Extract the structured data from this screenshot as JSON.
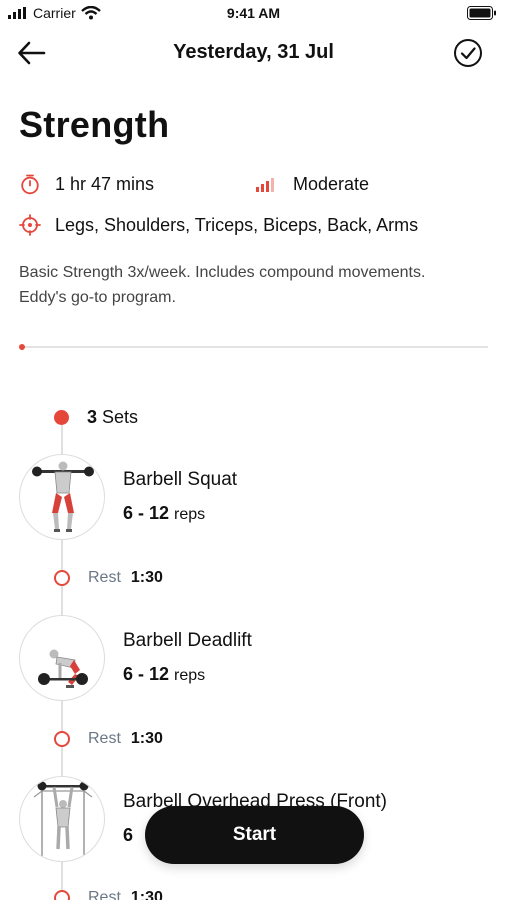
{
  "status_bar": {
    "carrier": "Carrier",
    "time": "9:41 AM"
  },
  "nav": {
    "title": "Yesterday, 31 Jul"
  },
  "workout": {
    "title": "Strength",
    "duration": "1 hr 47 mins",
    "intensity": "Moderate",
    "muscles": "Legs, Shoulders, Triceps, Biceps, Back, Arms",
    "description": "Basic Strength 3x/week. Includes compound movements. Eddy's go-to program."
  },
  "sets": {
    "count": "3",
    "label": "Sets"
  },
  "exercises": [
    {
      "name": "Barbell Squat",
      "reps_num": "6 - 12",
      "reps_unit": "reps"
    },
    {
      "name": "Barbell Deadlift",
      "reps_num": "6 - 12",
      "reps_unit": "reps"
    },
    {
      "name": "Barbell Overhead Press (Front)",
      "reps_num": "6",
      "reps_unit": ""
    }
  ],
  "rests": [
    {
      "label": "Rest",
      "value": "1:30"
    },
    {
      "label": "Rest",
      "value": "1:30"
    },
    {
      "label": "Rest",
      "value": "1:30"
    }
  ],
  "start_button": "Start",
  "colors": {
    "accent": "#e5483b",
    "button": "#111111",
    "muted_text": "#6b7785"
  }
}
